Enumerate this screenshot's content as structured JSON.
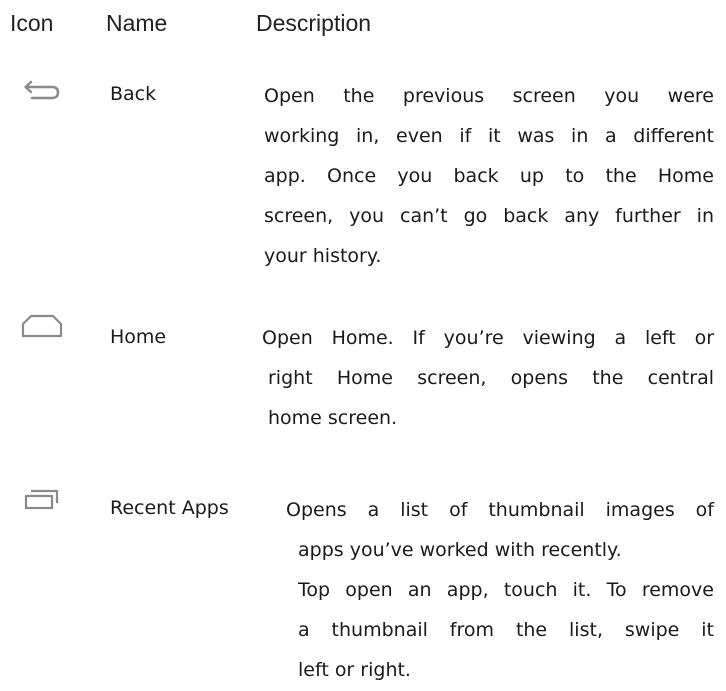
{
  "header": {
    "icon": "Icon",
    "name": "Name",
    "description": "Description"
  },
  "rows": [
    {
      "icon": "back-arrow-icon",
      "name": "Back",
      "lines": [
        "Open the previous screen you were",
        "working in, even if it was in a different",
        "app. Once you back up to the Home",
        "screen, you can’t go back any further in",
        "your history."
      ]
    },
    {
      "icon": "home-icon",
      "name": "Home",
      "lines": [
        "Open Home. If you’re viewing a left or",
        "right Home screen, opens the central",
        "home screen."
      ]
    },
    {
      "icon": "recent-apps-icon",
      "name": "Recent Apps",
      "lines": [
        "Opens a list of thumbnail images of",
        "apps you’ve worked with recently.",
        "Top open an app, touch it. To remove",
        "a thumbnail from the list, swipe it",
        "left or right."
      ]
    }
  ],
  "colors": {
    "icon_stroke": "#8a8a8a",
    "text": "#1a1a1a"
  }
}
